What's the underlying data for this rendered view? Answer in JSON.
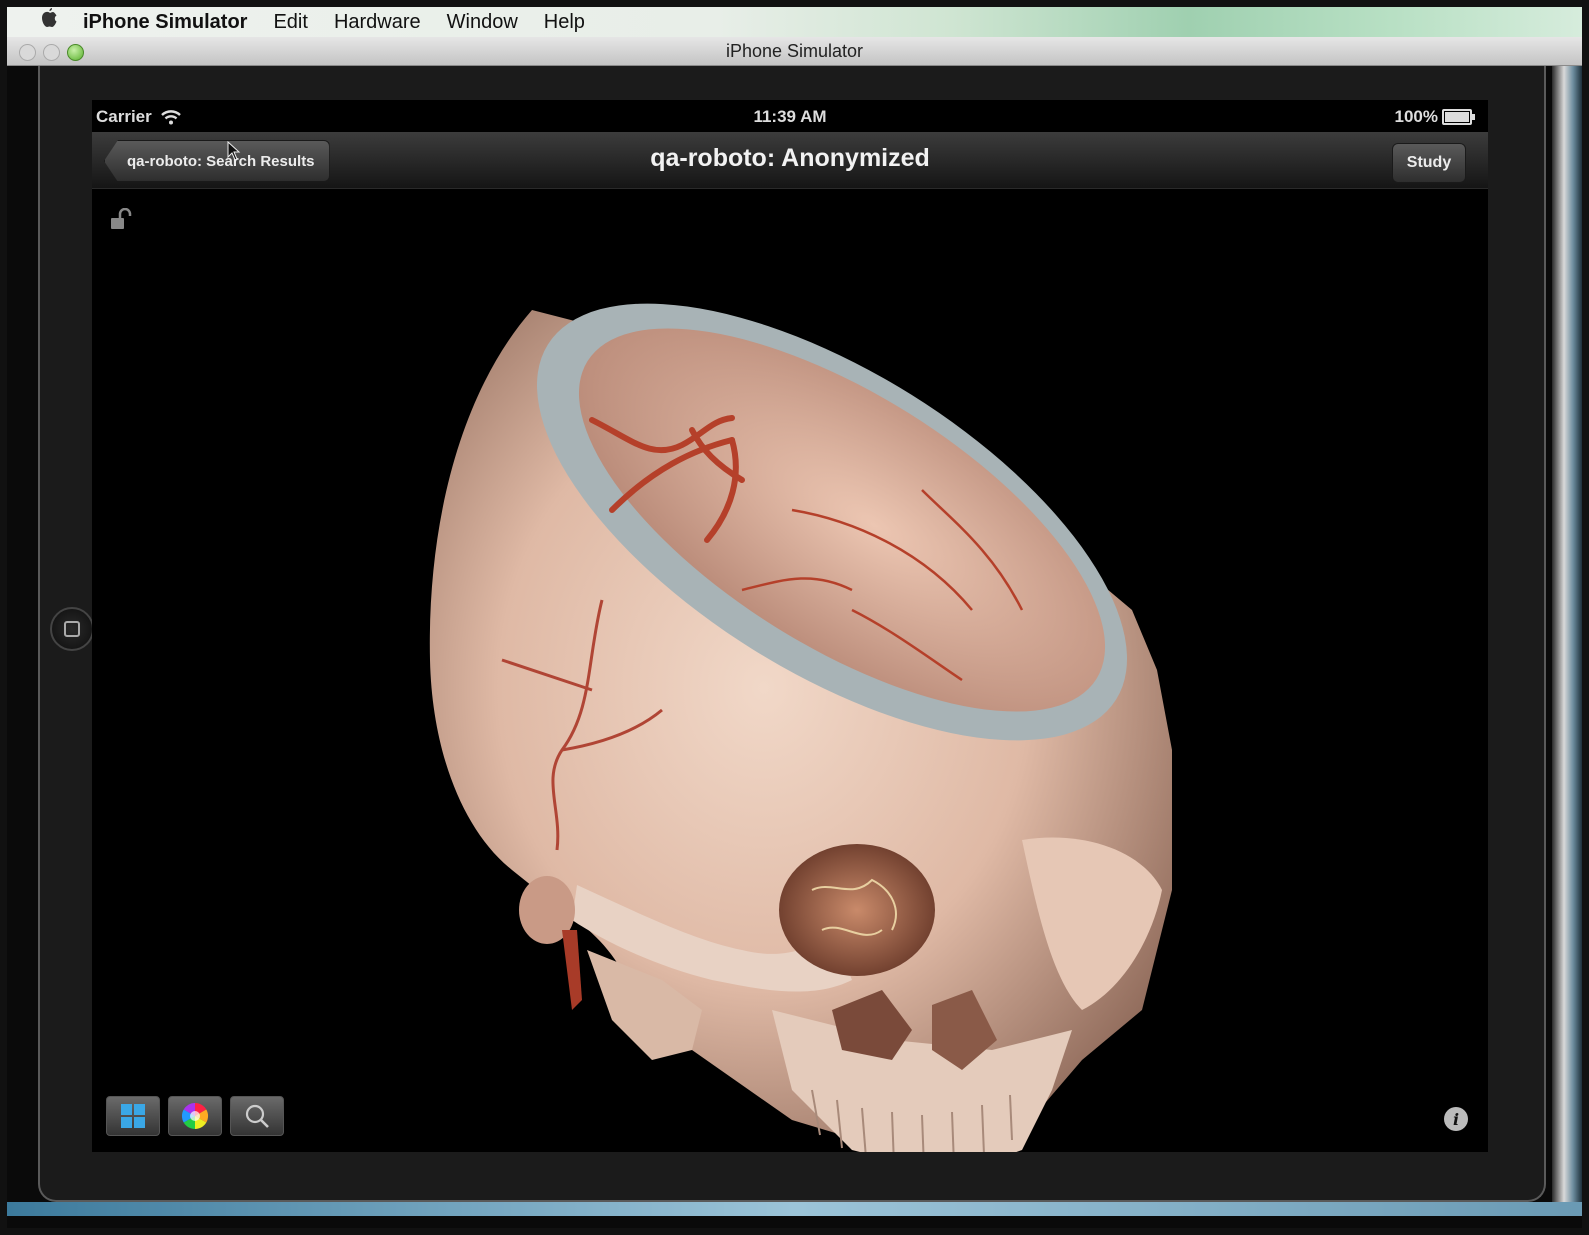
{
  "menubar": {
    "app_name": "iPhone Simulator",
    "items": [
      "Edit",
      "Hardware",
      "Window",
      "Help"
    ]
  },
  "window": {
    "title": "iPhone Simulator"
  },
  "statusbar": {
    "carrier": "Carrier",
    "time": "11:39 AM",
    "battery": "100%"
  },
  "navbar": {
    "back_label": "qa-roboto: Search Results",
    "title": "qa-roboto: Anonymized",
    "study_label": "Study"
  },
  "toolbar": {
    "icons": [
      "grid-icon",
      "color-wheel-icon",
      "magnifier-icon"
    ]
  },
  "colors": {
    "screen_bg": "#000000",
    "navbar_bg": "#2a2a2a",
    "bone": "#e9c9b8",
    "vessel": "#b5402a",
    "cut_edge": "#9aa5a8"
  }
}
